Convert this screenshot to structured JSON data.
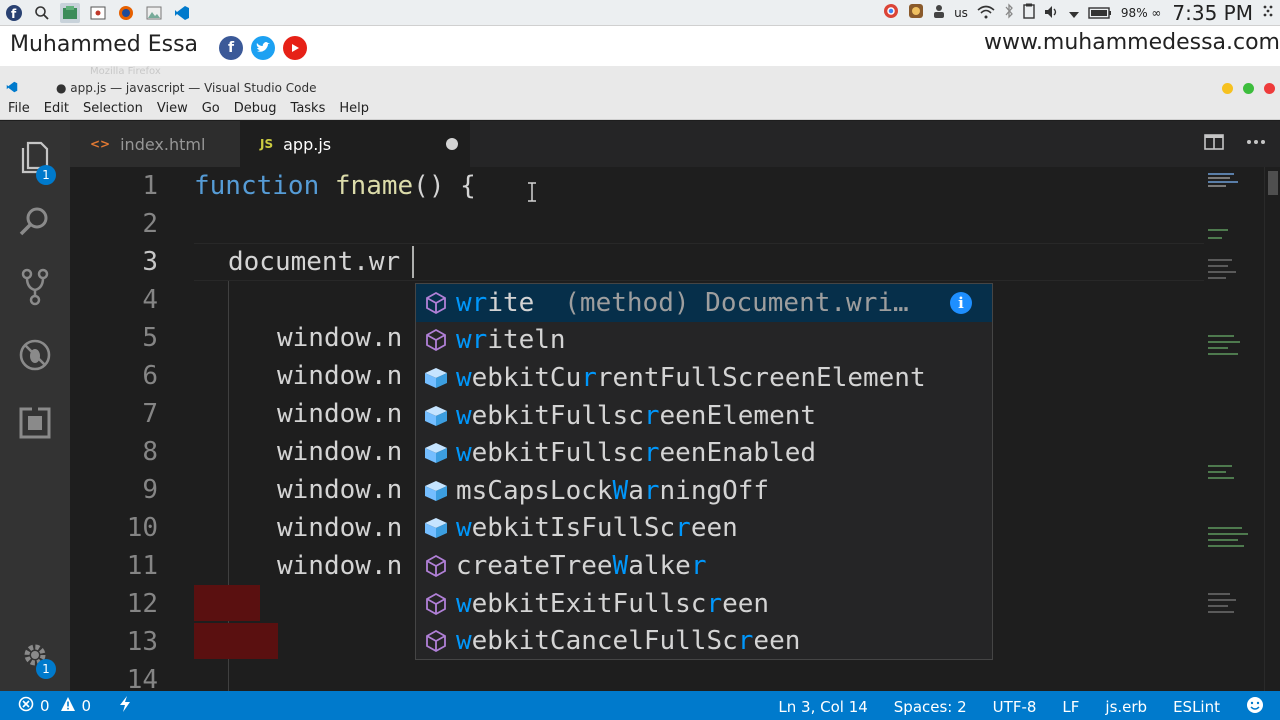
{
  "os_panel": {
    "keyboard_layout": "us",
    "battery": "98% ∞",
    "clock": "7:35 PM"
  },
  "banner": {
    "name": "Muhammed Essa",
    "url": "www.muhammedessa.com",
    "social_colors": {
      "facebook": "#3b5998",
      "twitter": "#1da1f2",
      "youtube": "#e62117"
    }
  },
  "ghost_window_title": "Mozilla Firefox",
  "window": {
    "title": "● app.js — javascript — Visual Studio Code"
  },
  "menu": [
    "File",
    "Edit",
    "Selection",
    "View",
    "Go",
    "Debug",
    "Tasks",
    "Help"
  ],
  "activity_bar": {
    "explorer_badge": "1",
    "settings_badge": "1",
    "items": [
      "files-icon",
      "search-icon",
      "source-control-icon",
      "debug-icon",
      "extensions-icon"
    ]
  },
  "tabs": [
    {
      "label": "index.html",
      "icon": "<>",
      "active": false
    },
    {
      "label": "app.js",
      "icon": "JS",
      "active": true,
      "dirty": true
    }
  ],
  "editor": {
    "line_numbers": [
      "1",
      "2",
      "3",
      "4",
      "5",
      "6",
      "7",
      "8",
      "9",
      "10",
      "11",
      "12",
      "13",
      "14"
    ],
    "lines": {
      "l1_kw": "function",
      "l1_fn": "fname",
      "l1_rest": "() {",
      "l3": "document.wr",
      "window_prefix": "window.n"
    }
  },
  "suggest": {
    "items": [
      {
        "icon": "method",
        "pre": "",
        "m1": "wr",
        "post": "ite",
        "detail": "(method) Document.wri…",
        "selected": true
      },
      {
        "icon": "method",
        "pre": "",
        "m1": "wr",
        "post": "iteln",
        "detail": ""
      },
      {
        "icon": "property",
        "pre": "",
        "m1": "w",
        "mid": "ebkitCu",
        "m2": "r",
        "post": "rentFullScreenElement"
      },
      {
        "icon": "property",
        "pre": "",
        "m1": "w",
        "mid": "ebkitFullsc",
        "m2": "r",
        "post": "eenElement"
      },
      {
        "icon": "property",
        "pre": "",
        "m1": "w",
        "mid": "ebkitFullsc",
        "m2": "r",
        "post": "eenEnabled"
      },
      {
        "icon": "property",
        "pre": "msCapsLock",
        "m1": "W",
        "mid": "a",
        "m2": "r",
        "post": "ningOff"
      },
      {
        "icon": "property",
        "pre": "",
        "m1": "w",
        "mid": "ebkitIsFullSc",
        "m2": "r",
        "post": "een"
      },
      {
        "icon": "method",
        "pre": "createTree",
        "m1": "W",
        "mid": "alke",
        "m2": "r",
        "post": ""
      },
      {
        "icon": "method",
        "pre": "",
        "m1": "w",
        "mid": "ebkitExitFullsc",
        "m2": "r",
        "post": "een"
      },
      {
        "icon": "method",
        "pre": "",
        "m1": "w",
        "mid": "ebkitCancelFullSc",
        "m2": "r",
        "post": "een"
      }
    ]
  },
  "statusbar": {
    "errors": "0",
    "warnings": "0",
    "position": "Ln 3, Col 14",
    "spaces": "Spaces: 2",
    "encoding": "UTF-8",
    "eol": "LF",
    "language": "js.erb",
    "linter": "ESLint"
  },
  "colors": {
    "accent": "#007acc",
    "keyword": "#569cd6",
    "function": "#dcdcaa",
    "match_highlight": "#0097fb",
    "method_icon": "#b180d7",
    "property_icon": "#75beff"
  }
}
